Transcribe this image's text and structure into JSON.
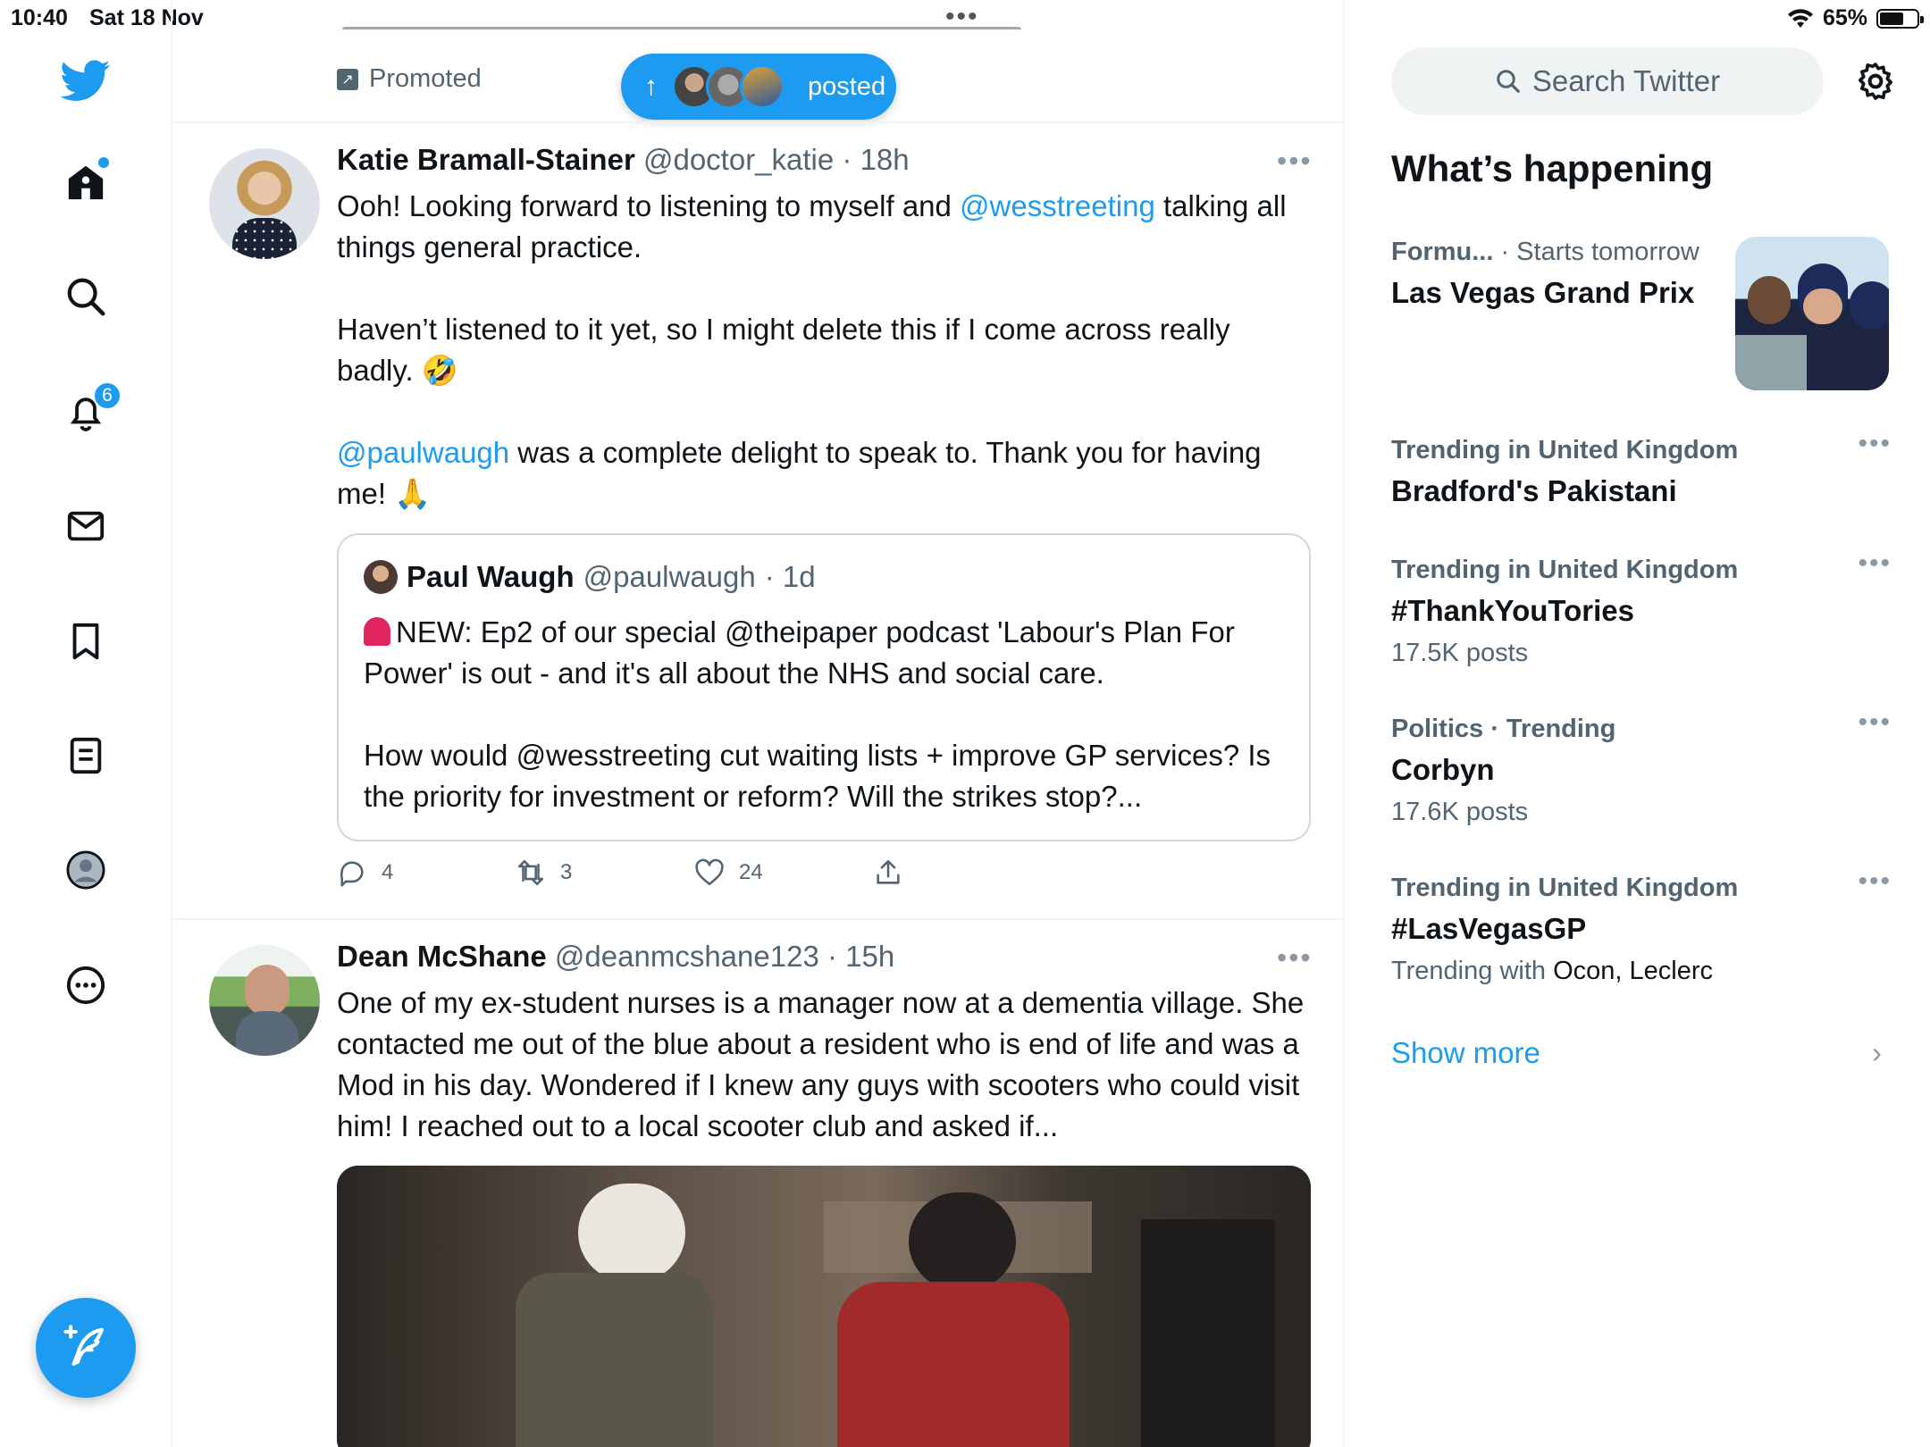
{
  "status_bar": {
    "time": "10:40",
    "date": "Sat 18 Nov",
    "battery": "65%",
    "battery_level": 0.65
  },
  "nav": {
    "notifications_badge": "6",
    "accent_color": "#1d9bf0",
    "icons": [
      "twitter-logo-icon",
      "home-icon",
      "search-icon",
      "bell-icon",
      "mail-icon",
      "bookmark-icon",
      "list-icon",
      "profile-icon",
      "more-circle-icon",
      "compose-icon"
    ]
  },
  "timeline": {
    "promoted_label": "Promoted",
    "new_posts_pill": {
      "label": "posted"
    },
    "tweets": [
      {
        "name": "Katie Bramall-Stainer",
        "handle": "@doctor_katie",
        "time": "· 18h",
        "body": {
          "p1_a": "Ooh! Looking forward to listening to myself and ",
          "p1_mention": "@wesstreeting",
          "p1_b": " talking all things general practice.",
          "p2": "Haven’t listened to it yet, so I might delete this if I come across really badly. 🤣",
          "p3_mention": "@paulwaugh",
          "p3_b": " was a complete delight to speak to. Thank you for having me! 🙏"
        },
        "quote": {
          "name": "Paul Waugh",
          "handle": "@paulwaugh",
          "time": "· 1d",
          "p1": "NEW:  Ep2 of our special @theipaper podcast 'Labour's Plan For Power' is out - and it's all about the NHS and social care.",
          "p2": "How would @wesstreeting cut waiting lists + improve GP services? Is the priority for investment or reform? Will the strikes stop?..."
        },
        "actions": {
          "replies": "4",
          "retweets": "3",
          "likes": "24"
        }
      },
      {
        "name": "Dean McShane",
        "handle": "@deanmcshane123",
        "time": "· 15h",
        "body": "One of my ex-student nurses is a manager now at a dementia village. She contacted me out of the blue about a resident who is end of life and was a Mod in his day. Wondered if I knew any guys with scooters who could visit him! I reached out to a local scooter club and asked if..."
      }
    ]
  },
  "sidebar": {
    "search_placeholder": "Search Twitter",
    "title": "What’s happening",
    "featured": {
      "category": "Formu...",
      "when": "· Starts tomorrow",
      "name": "Las Vegas Grand Prix"
    },
    "trends": [
      {
        "meta": "Trending in United Kingdom",
        "name": "Bradford's Pakistani"
      },
      {
        "meta": "Trending in United Kingdom",
        "name": "#ThankYouTories",
        "sub": "17.5K posts"
      },
      {
        "meta": "Politics · Trending",
        "name": "Corbyn",
        "sub": "17.6K posts"
      },
      {
        "meta": "Trending in United Kingdom",
        "name": "#LasVegasGP",
        "sub_prefix": "Trending with",
        "sub_names": "Ocon, Leclerc"
      }
    ],
    "show_more": "Show more"
  }
}
